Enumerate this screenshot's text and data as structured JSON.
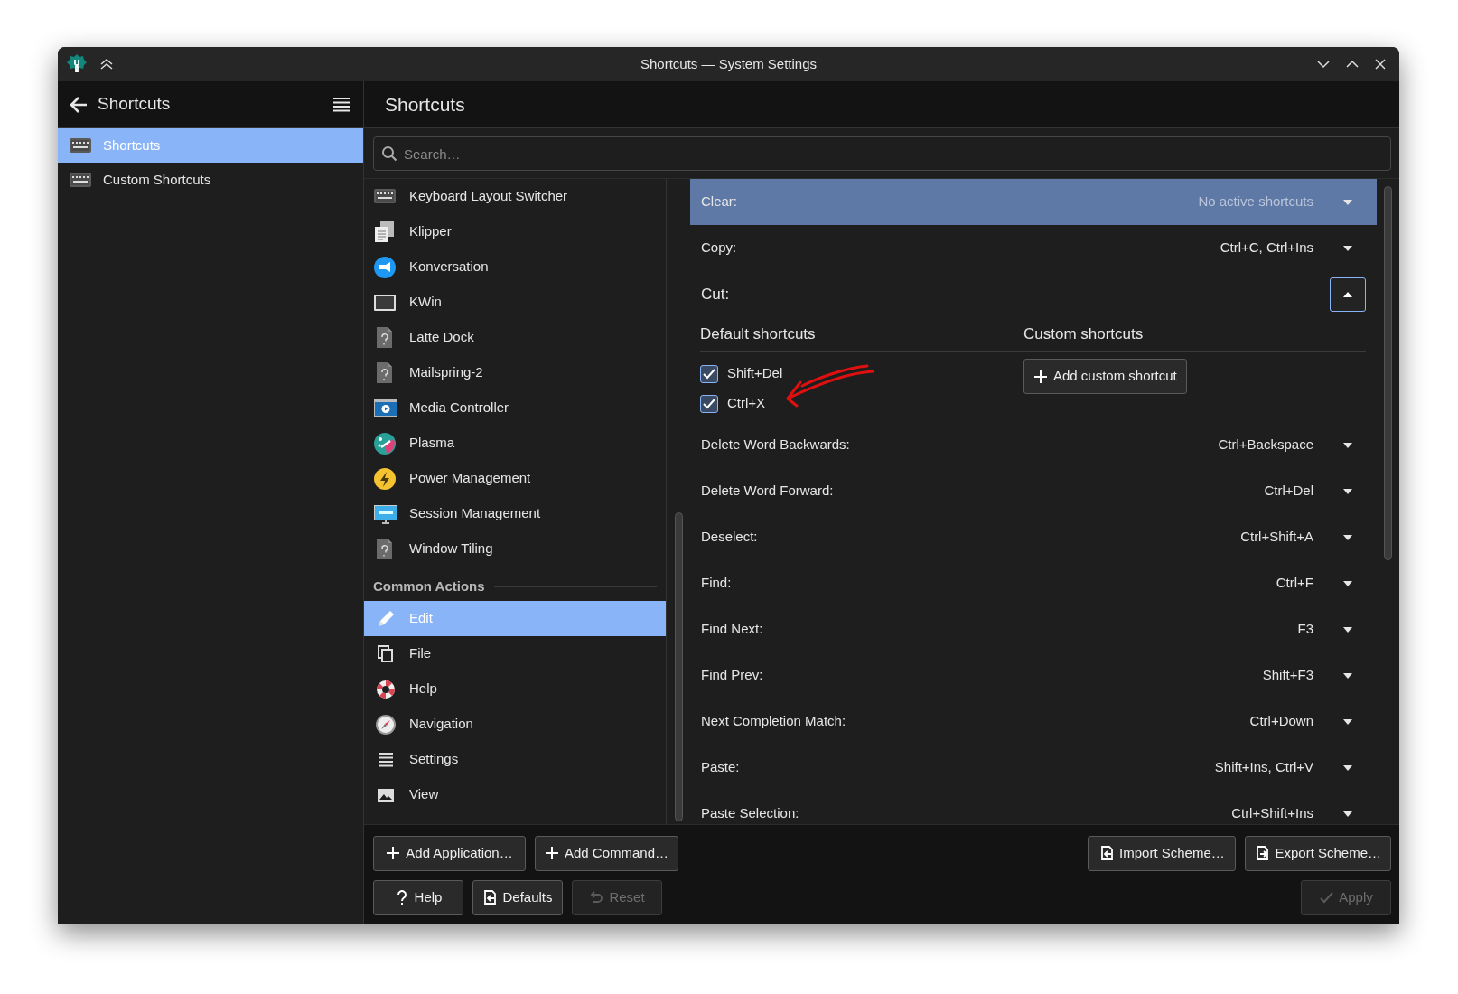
{
  "window": {
    "title": "Shortcuts — System Settings"
  },
  "sidebar": {
    "title": "Shortcuts",
    "items": [
      {
        "label": "Shortcuts",
        "selected": true
      },
      {
        "label": "Custom Shortcuts",
        "selected": false
      }
    ]
  },
  "page": {
    "title": "Shortcuts",
    "search": {
      "placeholder": "Search…"
    }
  },
  "applications": [
    {
      "label": "Keyboard Layout Switcher",
      "selected": false
    },
    {
      "label": "Klipper",
      "selected": false
    },
    {
      "label": "Konversation",
      "selected": false
    },
    {
      "label": "KWin",
      "selected": false
    },
    {
      "label": "Latte Dock",
      "selected": false
    },
    {
      "label": "Mailspring-2",
      "selected": false
    },
    {
      "label": "Media Controller",
      "selected": false
    },
    {
      "label": "Plasma",
      "selected": false
    },
    {
      "label": "Power Management",
      "selected": false
    },
    {
      "label": "Session Management",
      "selected": false
    },
    {
      "label": "Window Tiling",
      "selected": false
    }
  ],
  "common_actions": {
    "heading": "Common Actions",
    "items": [
      {
        "label": "Edit",
        "selected": true
      },
      {
        "label": "File",
        "selected": false
      },
      {
        "label": "Help",
        "selected": false
      },
      {
        "label": "Navigation",
        "selected": false
      },
      {
        "label": "Settings",
        "selected": false
      },
      {
        "label": "View",
        "selected": false
      }
    ]
  },
  "actions": [
    {
      "label": "Clear:",
      "shortcut": "No active shortcuts",
      "assigned": false,
      "selected": true,
      "expanded": false
    },
    {
      "label": "Copy:",
      "shortcut": "Ctrl+C, Ctrl+Ins",
      "assigned": true,
      "selected": false,
      "expanded": false
    },
    {
      "label": "Cut:",
      "selected": false,
      "expanded": true,
      "details": {
        "default_heading": "Default shortcuts",
        "custom_heading": "Custom shortcuts",
        "defaults": [
          {
            "label": "Shift+Del",
            "checked": true
          },
          {
            "label": "Ctrl+X",
            "checked": true
          }
        ],
        "add_button": "Add custom shortcut"
      }
    },
    {
      "label": "Delete Word Backwards:",
      "shortcut": "Ctrl+Backspace",
      "assigned": true,
      "selected": false,
      "expanded": false
    },
    {
      "label": "Delete Word Forward:",
      "shortcut": "Ctrl+Del",
      "assigned": true,
      "selected": false,
      "expanded": false
    },
    {
      "label": "Deselect:",
      "shortcut": "Ctrl+Shift+A",
      "assigned": true,
      "selected": false,
      "expanded": false
    },
    {
      "label": "Find:",
      "shortcut": "Ctrl+F",
      "assigned": true,
      "selected": false,
      "expanded": false
    },
    {
      "label": "Find Next:",
      "shortcut": "F3",
      "assigned": true,
      "selected": false,
      "expanded": false
    },
    {
      "label": "Find Prev:",
      "shortcut": "Shift+F3",
      "assigned": true,
      "selected": false,
      "expanded": false
    },
    {
      "label": "Next Completion Match:",
      "shortcut": "Ctrl+Down",
      "assigned": true,
      "selected": false,
      "expanded": false
    },
    {
      "label": "Paste:",
      "shortcut": "Shift+Ins, Ctrl+V",
      "assigned": true,
      "selected": false,
      "expanded": false
    },
    {
      "label": "Paste Selection:",
      "shortcut": "Ctrl+Shift+Ins",
      "assigned": true,
      "selected": false,
      "expanded": false
    }
  ],
  "toolbar_left": [
    {
      "label": "Add Application…",
      "disabled": false
    },
    {
      "label": "Add Command…",
      "disabled": false
    }
  ],
  "toolbar_right": [
    {
      "label": "Import Scheme…",
      "disabled": false
    },
    {
      "label": "Export Scheme…",
      "disabled": false
    }
  ],
  "footer_left": [
    {
      "label": "Help",
      "disabled": false
    },
    {
      "label": "Defaults",
      "disabled": false
    },
    {
      "label": "Reset",
      "disabled": true
    }
  ],
  "footer_right": [
    {
      "label": "Apply",
      "disabled": true
    }
  ]
}
